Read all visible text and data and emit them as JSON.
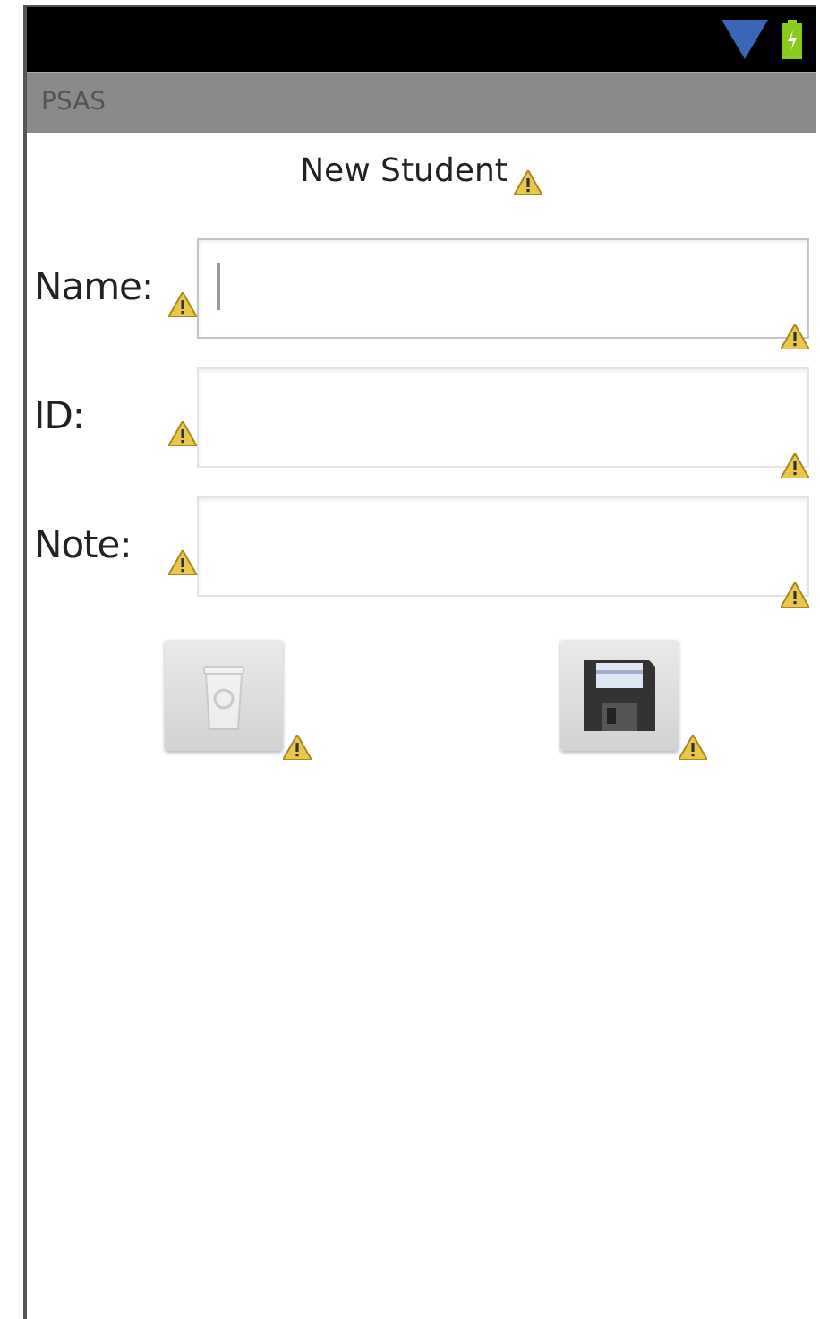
{
  "app_bar": {
    "title": "PSAS"
  },
  "heading": "New Student",
  "fields": [
    {
      "label": "Name:",
      "focused": true
    },
    {
      "label": "ID:",
      "focused": false
    },
    {
      "label": "Note:",
      "focused": false
    }
  ],
  "buttons": [
    {
      "kind": "delete",
      "disabled": true
    },
    {
      "kind": "save",
      "disabled": false
    }
  ]
}
